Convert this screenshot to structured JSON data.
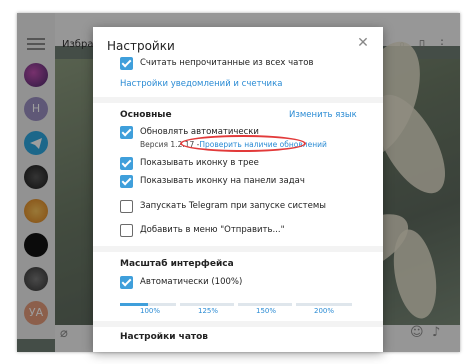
{
  "window": {
    "chat_title": "Избранн",
    "avatars": [
      {
        "text": "",
        "color": "#7a3b8c"
      },
      {
        "text": "Н",
        "color": "#9a8ec0"
      },
      {
        "text": "",
        "color": "#2ea6df"
      },
      {
        "text": "",
        "color": "#2c2c2c"
      },
      {
        "text": "",
        "color": "#e8a33a"
      },
      {
        "text": "",
        "color": "#121212"
      },
      {
        "text": "",
        "color": "#555555"
      },
      {
        "text": "УА",
        "color": "#e39a7a"
      }
    ]
  },
  "dialog": {
    "title": "Настройки",
    "close_icon": "close-icon",
    "notif": {
      "count_unread_label": "Считать непрочитанные из всех чатов",
      "count_unread_checked": true,
      "settings_link": "Настройки уведомлений и счетчика"
    },
    "general": {
      "heading": "Основные",
      "change_language": "Изменить язык",
      "auto_update_label": "Обновлять автоматически",
      "auto_update_checked": true,
      "version_text": "Версия 1.2.17 -",
      "check_updates_link": "Проверить наличие обновлений",
      "tray_icon_label": "Показывать иконку в трее",
      "tray_icon_checked": true,
      "taskbar_icon_label": "Показывать иконку на панели задач",
      "taskbar_icon_checked": true,
      "autostart_label": "Запускать Telegram при запуске системы",
      "autostart_checked": false,
      "send_to_label": "Добавить в меню \"Отправить...\"",
      "send_to_checked": false
    },
    "scale": {
      "heading": "Масштаб интерфейса",
      "auto_label": "Автоматически (100%)",
      "auto_checked": true,
      "ticks": [
        "100%",
        "125%",
        "150%",
        "200%"
      ],
      "selected_fraction": 0.12
    },
    "chats": {
      "heading": "Настройки чатов"
    }
  },
  "colors": {
    "accent": "#3f9fdb",
    "link": "#2a8bd4",
    "highlight": "#e23a3a"
  }
}
